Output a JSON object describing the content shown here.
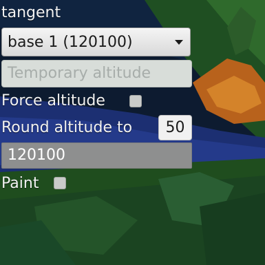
{
  "panel": {
    "title": "tangent",
    "base_select": {
      "selected": "base 1 (120100)"
    },
    "temporary_altitude": {
      "placeholder": "Temporary altitude",
      "value": ""
    },
    "force_altitude": {
      "label": "Force altitude",
      "checked": false
    },
    "round_altitude": {
      "label": "Round altitude to",
      "value": "50"
    },
    "altitude_value": "120100",
    "paint": {
      "label": "Paint",
      "checked": false
    }
  },
  "colors": {
    "background_sky": "#0c1a2c",
    "terrain_green": "#2b6b2a",
    "foliage_orange": "#c26a1e",
    "water_blue": "#1d2f7a",
    "text_light": "#f2f2f2",
    "value_box_gray": "#8e8f8f"
  }
}
